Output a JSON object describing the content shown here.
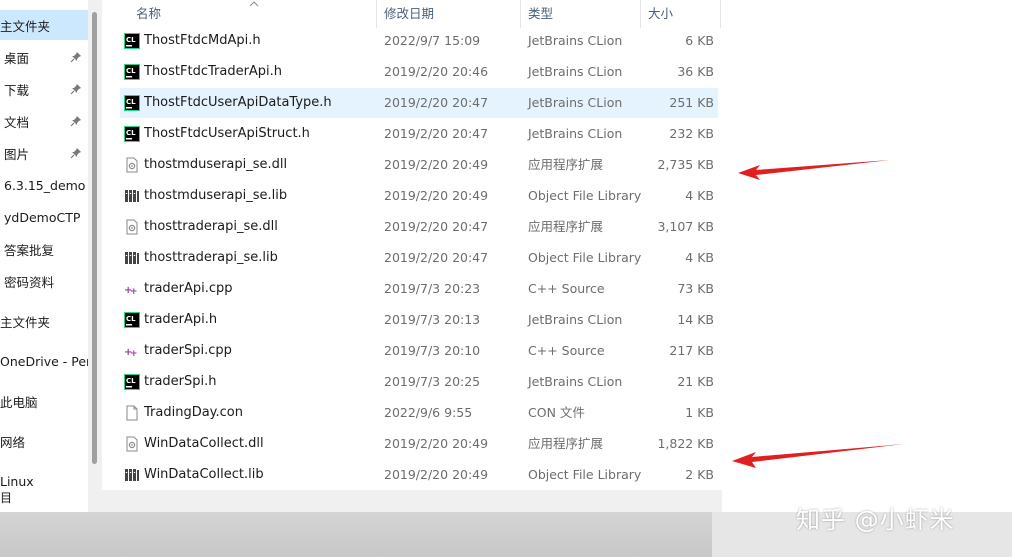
{
  "sidebar": {
    "items": [
      {
        "label": "主文件夹",
        "selected": true,
        "pinned": false
      },
      {
        "label": "桌面",
        "selected": false,
        "pinned": true
      },
      {
        "label": "下载",
        "selected": false,
        "pinned": true
      },
      {
        "label": "文档",
        "selected": false,
        "pinned": true
      },
      {
        "label": "图片",
        "selected": false,
        "pinned": true
      },
      {
        "label": "6.3.15_demo",
        "selected": false,
        "pinned": false
      },
      {
        "label": "ydDemoCTP",
        "selected": false,
        "pinned": false
      },
      {
        "label": "答案批复",
        "selected": false,
        "pinned": false
      },
      {
        "label": "密码资料",
        "selected": false,
        "pinned": false
      },
      {
        "label": "主文件夹",
        "selected": false,
        "pinned": false
      },
      {
        "label": "OneDrive - Pers",
        "selected": false,
        "pinned": false
      },
      {
        "label": "此电脑",
        "selected": false,
        "pinned": false
      },
      {
        "label": "网络",
        "selected": false,
        "pinned": false
      },
      {
        "label": "Linux",
        "selected": false,
        "pinned": false
      }
    ],
    "bottom_text": "目"
  },
  "columns": {
    "name": "名称",
    "date": "修改日期",
    "type": "类型",
    "size": "大小"
  },
  "files": [
    {
      "name": "ThostFtdcMdApi.h",
      "date": "2022/9/7 15:09",
      "type": "JetBrains CLion",
      "size": "6 KB",
      "icon": "clion-icon"
    },
    {
      "name": "ThostFtdcTraderApi.h",
      "date": "2019/2/20 20:46",
      "type": "JetBrains CLion",
      "size": "36 KB",
      "icon": "clion-icon"
    },
    {
      "name": "ThostFtdcUserApiDataType.h",
      "date": "2019/2/20 20:47",
      "type": "JetBrains CLion",
      "size": "251 KB",
      "icon": "clion-icon",
      "selected": true
    },
    {
      "name": "ThostFtdcUserApiStruct.h",
      "date": "2019/2/20 20:47",
      "type": "JetBrains CLion",
      "size": "232 KB",
      "icon": "clion-icon"
    },
    {
      "name": "thostmduserapi_se.dll",
      "date": "2019/2/20 20:49",
      "type": "应用程序扩展",
      "size": "2,735 KB",
      "icon": "dll-icon"
    },
    {
      "name": "thostmduserapi_se.lib",
      "date": "2019/2/20 20:49",
      "type": "Object File Library",
      "size": "4 KB",
      "icon": "lib-icon"
    },
    {
      "name": "thosttraderapi_se.dll",
      "date": "2019/2/20 20:47",
      "type": "应用程序扩展",
      "size": "3,107 KB",
      "icon": "dll-icon"
    },
    {
      "name": "thosttraderapi_se.lib",
      "date": "2019/2/20 20:47",
      "type": "Object File Library",
      "size": "4 KB",
      "icon": "lib-icon"
    },
    {
      "name": "traderApi.cpp",
      "date": "2019/7/3 20:23",
      "type": "C++ Source",
      "size": "73 KB",
      "icon": "cpp-icon"
    },
    {
      "name": "traderApi.h",
      "date": "2019/7/3 20:13",
      "type": "JetBrains CLion",
      "size": "14 KB",
      "icon": "clion-icon"
    },
    {
      "name": "traderSpi.cpp",
      "date": "2019/7/3 20:10",
      "type": "C++ Source",
      "size": "217 KB",
      "icon": "cpp-icon"
    },
    {
      "name": "traderSpi.h",
      "date": "2019/7/3 20:25",
      "type": "JetBrains CLion",
      "size": "21 KB",
      "icon": "clion-icon"
    },
    {
      "name": "TradingDay.con",
      "date": "2022/9/6 9:55",
      "type": "CON 文件",
      "size": "1 KB",
      "icon": "file-icon"
    },
    {
      "name": "WinDataCollect.dll",
      "date": "2019/2/20 20:49",
      "type": "应用程序扩展",
      "size": "1,822 KB",
      "icon": "dll-icon"
    },
    {
      "name": "WinDataCollect.lib",
      "date": "2019/2/20 20:49",
      "type": "Object File Library",
      "size": "2 KB",
      "icon": "lib-icon"
    }
  ],
  "watermark": "知乎 @小虾米",
  "colors": {
    "selection": "#cce8ff",
    "row_highlight": "#e5f3ff",
    "arrow": "#e02020",
    "header_text": "#4c607a"
  }
}
